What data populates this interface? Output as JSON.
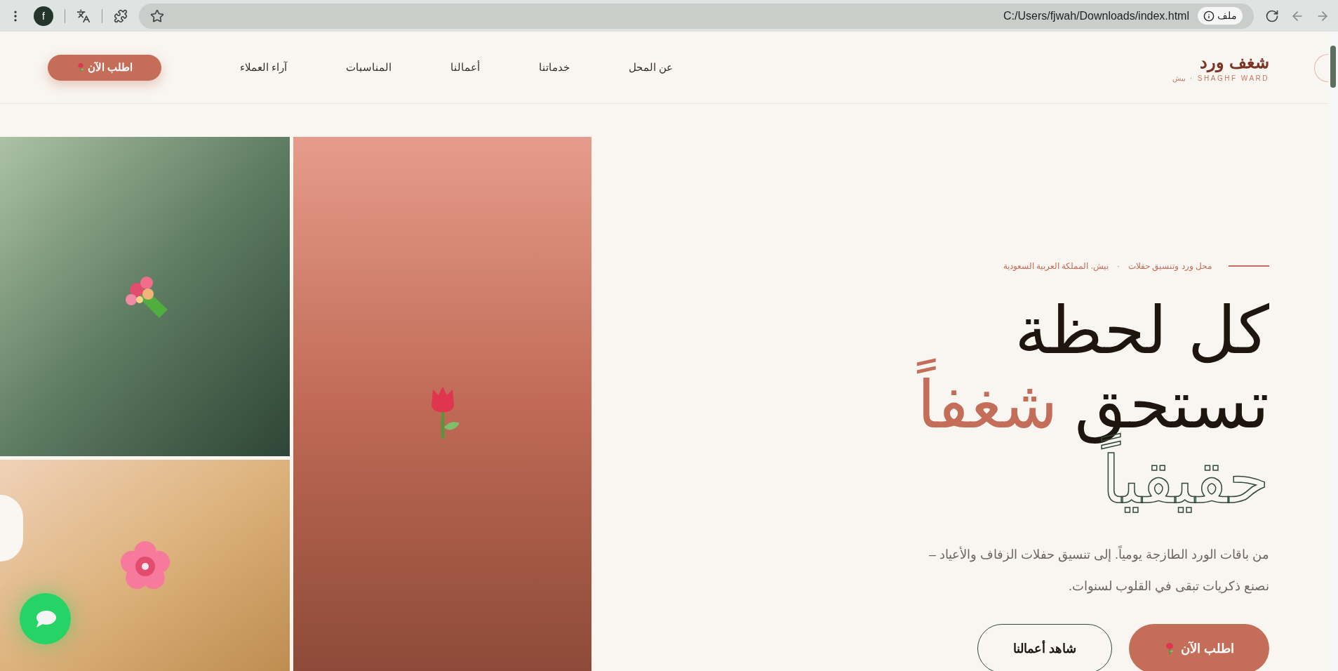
{
  "browser": {
    "address": "C:/Users/fjwah/Downloads/index.html",
    "site_chip": "ملف",
    "profile": "f"
  },
  "nav": {
    "brand": "شغف ورد",
    "brand_sub": "SHAGHF WARD · بيش",
    "links": [
      {
        "label": "عن المحل"
      },
      {
        "label": "خدماتنا"
      },
      {
        "label": "أعمالنا"
      },
      {
        "label": "المناسبات"
      },
      {
        "label": "آراء العملاء"
      }
    ],
    "cta": "اطلب الآن"
  },
  "hero": {
    "tagline": [
      "محل ورد وتنسيق حفلات",
      "·",
      "بيش. المملكة العربية السعودية"
    ],
    "heading": {
      "line1": "كل لحظة",
      "line2": "تستحق",
      "accent": "شغفاً",
      "outline": "حقيقياً"
    },
    "paragraph": [
      "من باقات الورد الطازجة يومياً. إلى تنسيق حفلات الزفاف والأعياد –",
      "نصنع ذكريات تبقى في القلوب لسنوات."
    ],
    "buttons": [
      {
        "kind": "primary",
        "label": "اطلب الآن"
      },
      {
        "kind": "secondary",
        "label": "شاهد أعمالنا"
      }
    ]
  },
  "tiles": [
    {
      "kind": "bouquet"
    },
    {
      "kind": "tulip"
    },
    {
      "kind": "blossom"
    }
  ]
}
